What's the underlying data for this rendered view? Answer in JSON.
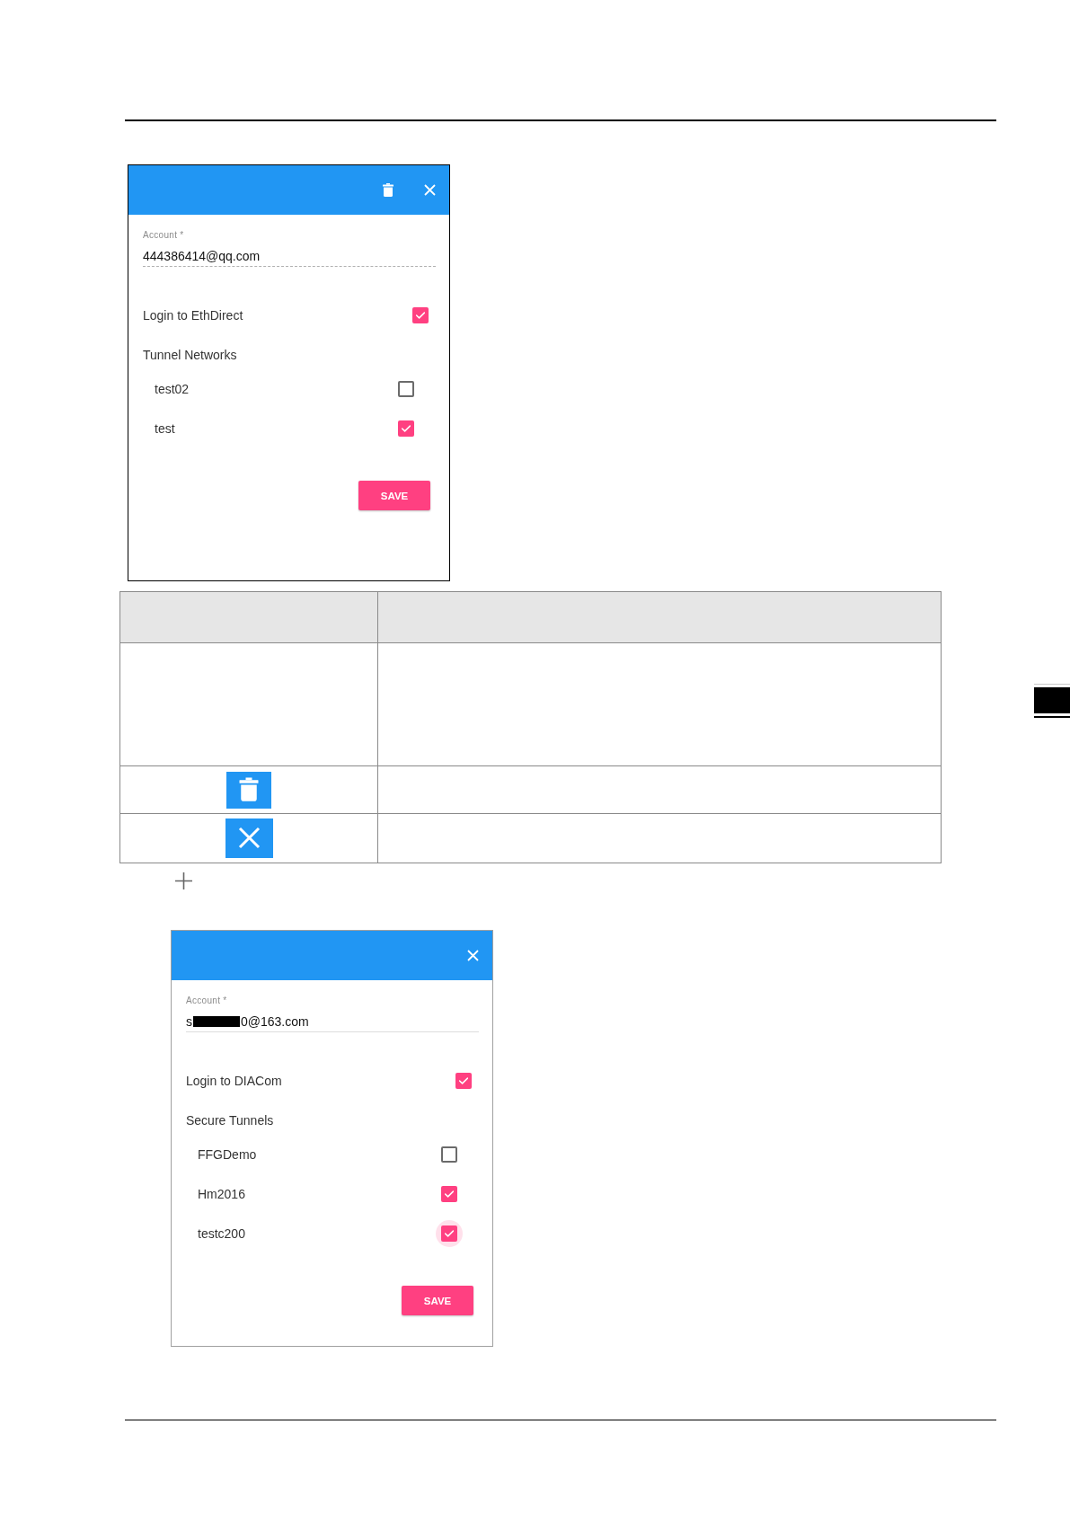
{
  "sections": [
    {
      "kind": "dialog",
      "header_buttons": [
        {
          "kind": "delete"
        },
        {
          "kind": "close"
        }
      ],
      "account": {
        "label": "Account *",
        "value": "444386414@qq.com",
        "disabled": true
      },
      "login": {
        "label": "Login to EthDirect",
        "checked": true
      },
      "tunnels": {
        "title": "Tunnel Networks",
        "items": [
          {
            "name": "test02",
            "checked": false
          },
          {
            "name": "test",
            "checked": true
          }
        ]
      },
      "save_button": "SAVE"
    },
    {
      "kind": "table",
      "rows": [
        {
          "kind": "header"
        },
        {
          "kind": "blank"
        },
        {
          "kind": "trash"
        },
        {
          "kind": "close"
        }
      ]
    },
    {
      "kind": "dialog",
      "header_buttons": [
        {
          "kind": "close"
        }
      ],
      "account": {
        "label": "Account *",
        "value_parts": [
          "s",
          "0@163.com"
        ],
        "redacted": true,
        "disabled": false
      },
      "login": {
        "label": "Login to DIACom",
        "checked": true
      },
      "tunnels": {
        "title": "Secure Tunnels",
        "items": [
          {
            "name": "FFGDemo",
            "checked": false,
            "focused": false
          },
          {
            "name": "Hm2016",
            "checked": true,
            "focused": false
          },
          {
            "name": "testc200",
            "checked": true,
            "focused": true
          }
        ]
      },
      "save_button": "SAVE"
    }
  ]
}
